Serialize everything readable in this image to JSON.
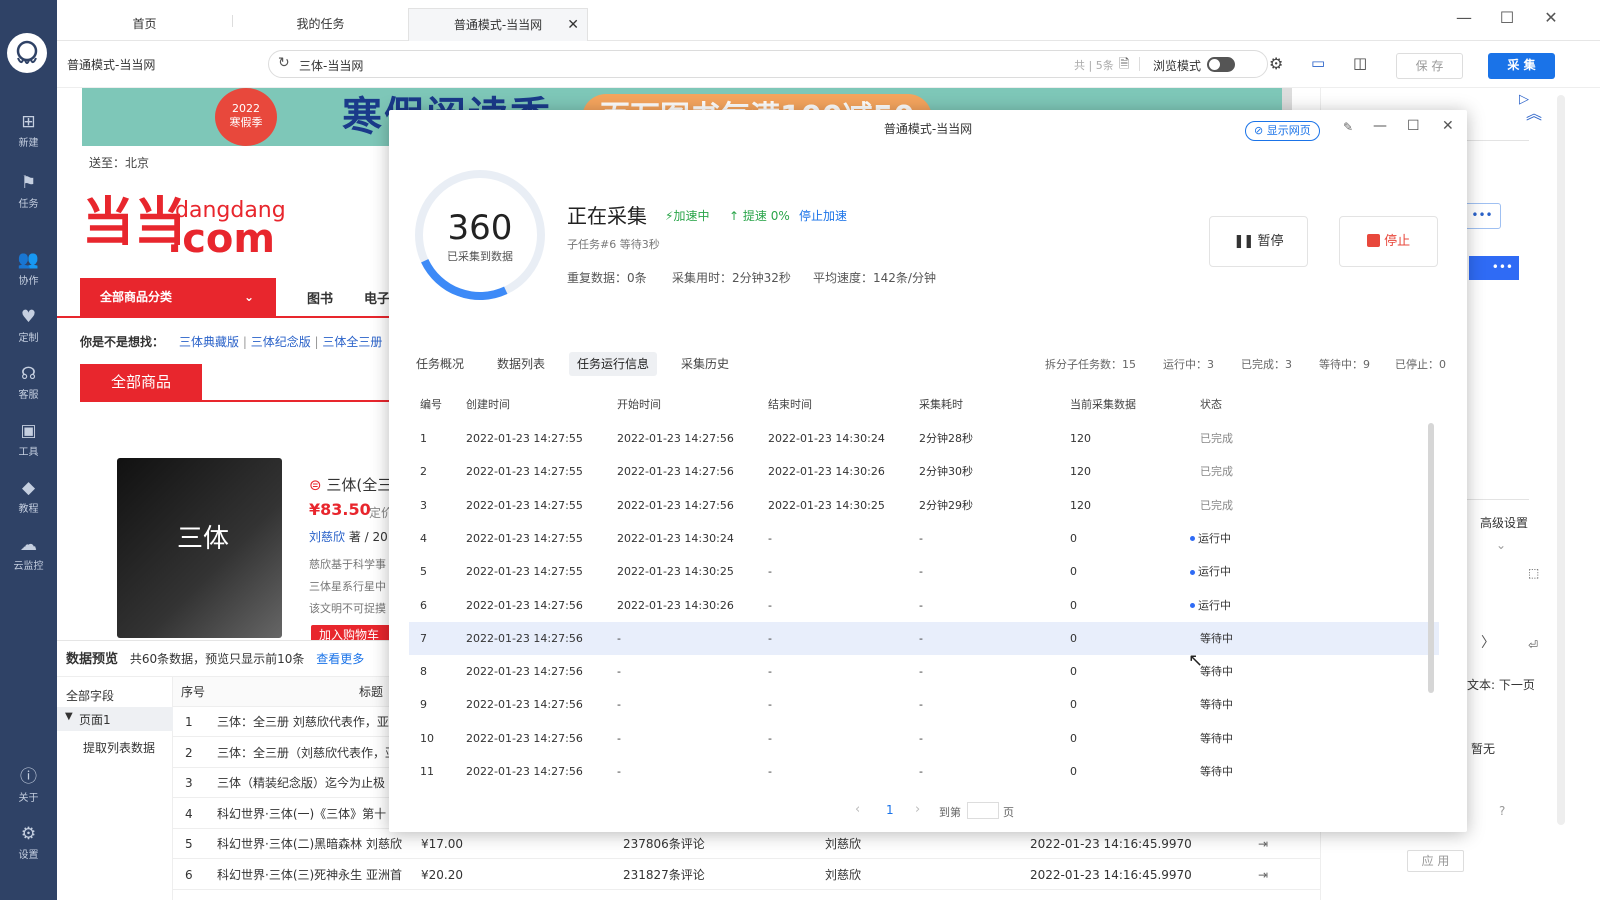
{
  "sidebar": {
    "items": [
      {
        "label": "新建",
        "icon": "plus-icon"
      },
      {
        "label": "任务",
        "icon": "bookmark-icon"
      },
      {
        "label": "协作",
        "icon": "people-icon"
      },
      {
        "label": "定制",
        "icon": "heart-icon"
      },
      {
        "label": "客服",
        "icon": "headset-icon"
      },
      {
        "label": "工具",
        "icon": "toolbox-icon"
      },
      {
        "label": "教程",
        "icon": "graduation-icon"
      },
      {
        "label": "云监控",
        "icon": "cloud-icon"
      },
      {
        "label": "关于",
        "icon": "info-icon"
      },
      {
        "label": "设置",
        "icon": "gear-icon"
      }
    ]
  },
  "tabs": [
    {
      "label": "首页"
    },
    {
      "label": "我的任务"
    },
    {
      "label": "普通模式-当当网",
      "active": true
    }
  ],
  "addressbar": {
    "page_label": "普通模式-当当网",
    "url": "三体-当当网",
    "count_hint": "共 | 5条",
    "browse_mode_label": "浏览模式",
    "save_label": "保 存",
    "collect_label": "采 集"
  },
  "background_page": {
    "banner_year": "2022",
    "banner_badge": "寒假季",
    "banner_headline": "寒假阅读季",
    "banner_promo": "百万图书每满100减50",
    "deliver_to": "送至：北京",
    "logo_word": "dangdang",
    "logo_com": ".com",
    "category_label": "全部商品分类",
    "nav_books": "图书",
    "nav_e": "电子",
    "suggest_label": "你是不是想找：",
    "suggestions": [
      "三体典藏版",
      "三体纪念版",
      "三体全三册"
    ],
    "all_goods": "全部商品",
    "product_title": "三体(全三",
    "product_price": "¥83.50",
    "product_price_note": "定价",
    "product_author": "刘慈欣",
    "product_author_suffix": "著 / 201",
    "product_desc": [
      "慈欣基于科学事",
      "三体星系行星中",
      "该文明不可捉摸"
    ],
    "add_cart": "加入购物车"
  },
  "preview": {
    "title": "数据预览",
    "summary": "共60条数据，预览只显示前10条",
    "more_link": "查看更多",
    "tree_all": "全部字段",
    "tree_page": "页面1",
    "tree_child": "提取列表数据",
    "col_index": "序号",
    "col_title": "标题",
    "rows": [
      {
        "n": "1",
        "title": "三体：全三册 刘慈欣代表作，亚洲",
        "price": "",
        "comments": "",
        "author": "",
        "time": ""
      },
      {
        "n": "2",
        "title": "三体：全三册（刘慈欣代表作，亚",
        "price": "",
        "comments": "",
        "author": "",
        "time": ""
      },
      {
        "n": "3",
        "title": "三体（精装纪念版）迄今为止极",
        "price": "",
        "comments": "",
        "author": "",
        "time": ""
      },
      {
        "n": "4",
        "title": "科幻世界·三体(一)《三体》第十",
        "price": "",
        "comments": "",
        "author": "",
        "time": ""
      },
      {
        "n": "5",
        "title": "科幻世界·三体(二)黑暗森林 刘慈欣...",
        "price": "¥17.00",
        "comments": "237806条评论",
        "author": "刘慈欣",
        "time": "2022-01-23 14:16:45.9970"
      },
      {
        "n": "6",
        "title": "科幻世界·三体(三)死神永生 亚洲首...",
        "price": "¥20.20",
        "comments": "231827条评论",
        "author": "刘慈欣",
        "time": "2022-01-23 14:16:45.9970"
      }
    ]
  },
  "right_panel": {
    "advanced": "高级设置",
    "text_next": "文本:  下一页",
    "none_label": "暂无",
    "apply": "应 用"
  },
  "modal": {
    "title": "普通模式-当当网",
    "show_page": "显示网页",
    "collected_count": "360",
    "collected_label": "已采集到数据",
    "status": "正在采集",
    "accelerating": "加速中",
    "speedup": "提速 0%",
    "stop_accel": "停止加速",
    "subtask_wait": "子任务#6 等待3秒",
    "duplicate": "重复数据：",
    "duplicate_val": "0条",
    "elapsed": "采集用时：",
    "elapsed_val": "2分钟32秒",
    "speed": "平均速度：",
    "speed_val": "142条/分钟",
    "pause": "暂停",
    "stop": "停止",
    "tabs": [
      "任务概况",
      "数据列表",
      "任务运行信息",
      "采集历史"
    ],
    "stats": {
      "split": "拆分子任务数：15",
      "running": "运行中：3",
      "done": "已完成：3",
      "waiting": "等待中：9",
      "stopped": "已停止：0"
    },
    "columns": [
      "编号",
      "创建时间",
      "开始时间",
      "结束时间",
      "采集耗时",
      "当前采集数据",
      "状态"
    ],
    "rows": [
      {
        "id": "1",
        "created": "2022-01-23 14:27:55",
        "start": "2022-01-23 14:27:56",
        "end": "2022-01-23 14:30:24",
        "dur": "2分钟28秒",
        "count": "120",
        "status": "已完成",
        "state": "done"
      },
      {
        "id": "2",
        "created": "2022-01-23 14:27:55",
        "start": "2022-01-23 14:27:56",
        "end": "2022-01-23 14:30:26",
        "dur": "2分钟30秒",
        "count": "120",
        "status": "已完成",
        "state": "done"
      },
      {
        "id": "3",
        "created": "2022-01-23 14:27:55",
        "start": "2022-01-23 14:27:56",
        "end": "2022-01-23 14:30:25",
        "dur": "2分钟29秒",
        "count": "120",
        "status": "已完成",
        "state": "done"
      },
      {
        "id": "4",
        "created": "2022-01-23 14:27:55",
        "start": "2022-01-23 14:30:24",
        "end": "-",
        "dur": "-",
        "count": "0",
        "status": "运行中",
        "state": "running"
      },
      {
        "id": "5",
        "created": "2022-01-23 14:27:55",
        "start": "2022-01-23 14:30:25",
        "end": "-",
        "dur": "-",
        "count": "0",
        "status": "运行中",
        "state": "running"
      },
      {
        "id": "6",
        "created": "2022-01-23 14:27:56",
        "start": "2022-01-23 14:30:26",
        "end": "-",
        "dur": "-",
        "count": "0",
        "status": "运行中",
        "state": "running"
      },
      {
        "id": "7",
        "created": "2022-01-23 14:27:56",
        "start": "-",
        "end": "-",
        "dur": "-",
        "count": "0",
        "status": "等待中",
        "state": "waiting",
        "highlight": true
      },
      {
        "id": "8",
        "created": "2022-01-23 14:27:56",
        "start": "-",
        "end": "-",
        "dur": "-",
        "count": "0",
        "status": "等待中",
        "state": "waiting"
      },
      {
        "id": "9",
        "created": "2022-01-23 14:27:56",
        "start": "-",
        "end": "-",
        "dur": "-",
        "count": "0",
        "status": "等待中",
        "state": "waiting"
      },
      {
        "id": "10",
        "created": "2022-01-23 14:27:56",
        "start": "-",
        "end": "-",
        "dur": "-",
        "count": "0",
        "status": "等待中",
        "state": "waiting"
      },
      {
        "id": "11",
        "created": "2022-01-23 14:27:56",
        "start": "-",
        "end": "-",
        "dur": "-",
        "count": "0",
        "status": "等待中",
        "state": "waiting"
      }
    ],
    "pager": {
      "current": "1",
      "goto_label": "到第",
      "page_suffix": "页"
    }
  },
  "colors": {
    "sidebar": "#2f4266",
    "primary": "#1a73e8",
    "brand_red": "#e8262d",
    "accent_green": "#2aa54a",
    "highlight_row": "#e8eefb"
  }
}
